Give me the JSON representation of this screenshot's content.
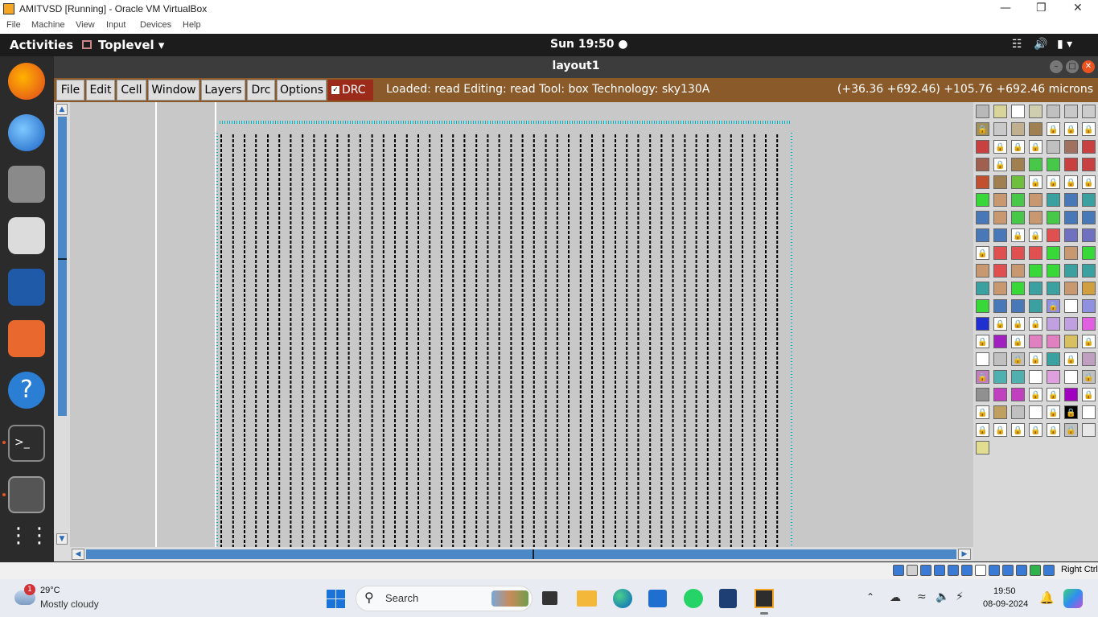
{
  "vbox": {
    "title": "AMITVSD [Running] - Oracle VM VirtualBox",
    "menu": [
      "File",
      "Machine",
      "View",
      "Input",
      "Devices",
      "Help"
    ],
    "host_key": "Right Ctrl"
  },
  "ubuntu": {
    "activities": "Activities",
    "app_menu": "Toplevel",
    "clock": "Sun 19:50"
  },
  "magic": {
    "window_title": "layout1",
    "menus": [
      "File",
      "Edit",
      "Cell",
      "Window",
      "Layers",
      "Drc",
      "Options"
    ],
    "drc_label": "DRC",
    "status": "Loaded: read Editing: read Tool: box  Technology: sky130A",
    "coords": "(+36.36 +692.46) +105.76 +692.46 microns"
  },
  "taskbar": {
    "weather_temp": "29°C",
    "weather_desc": "Mostly cloudy",
    "weather_badge": "1",
    "search_placeholder": "Search",
    "time": "19:50",
    "date": "08-09-2024"
  },
  "colors": {
    "magic_menubar": "#8b5a2b",
    "drc_red": "#9b2c1b",
    "canvas_bg": "#c8c8c8"
  }
}
